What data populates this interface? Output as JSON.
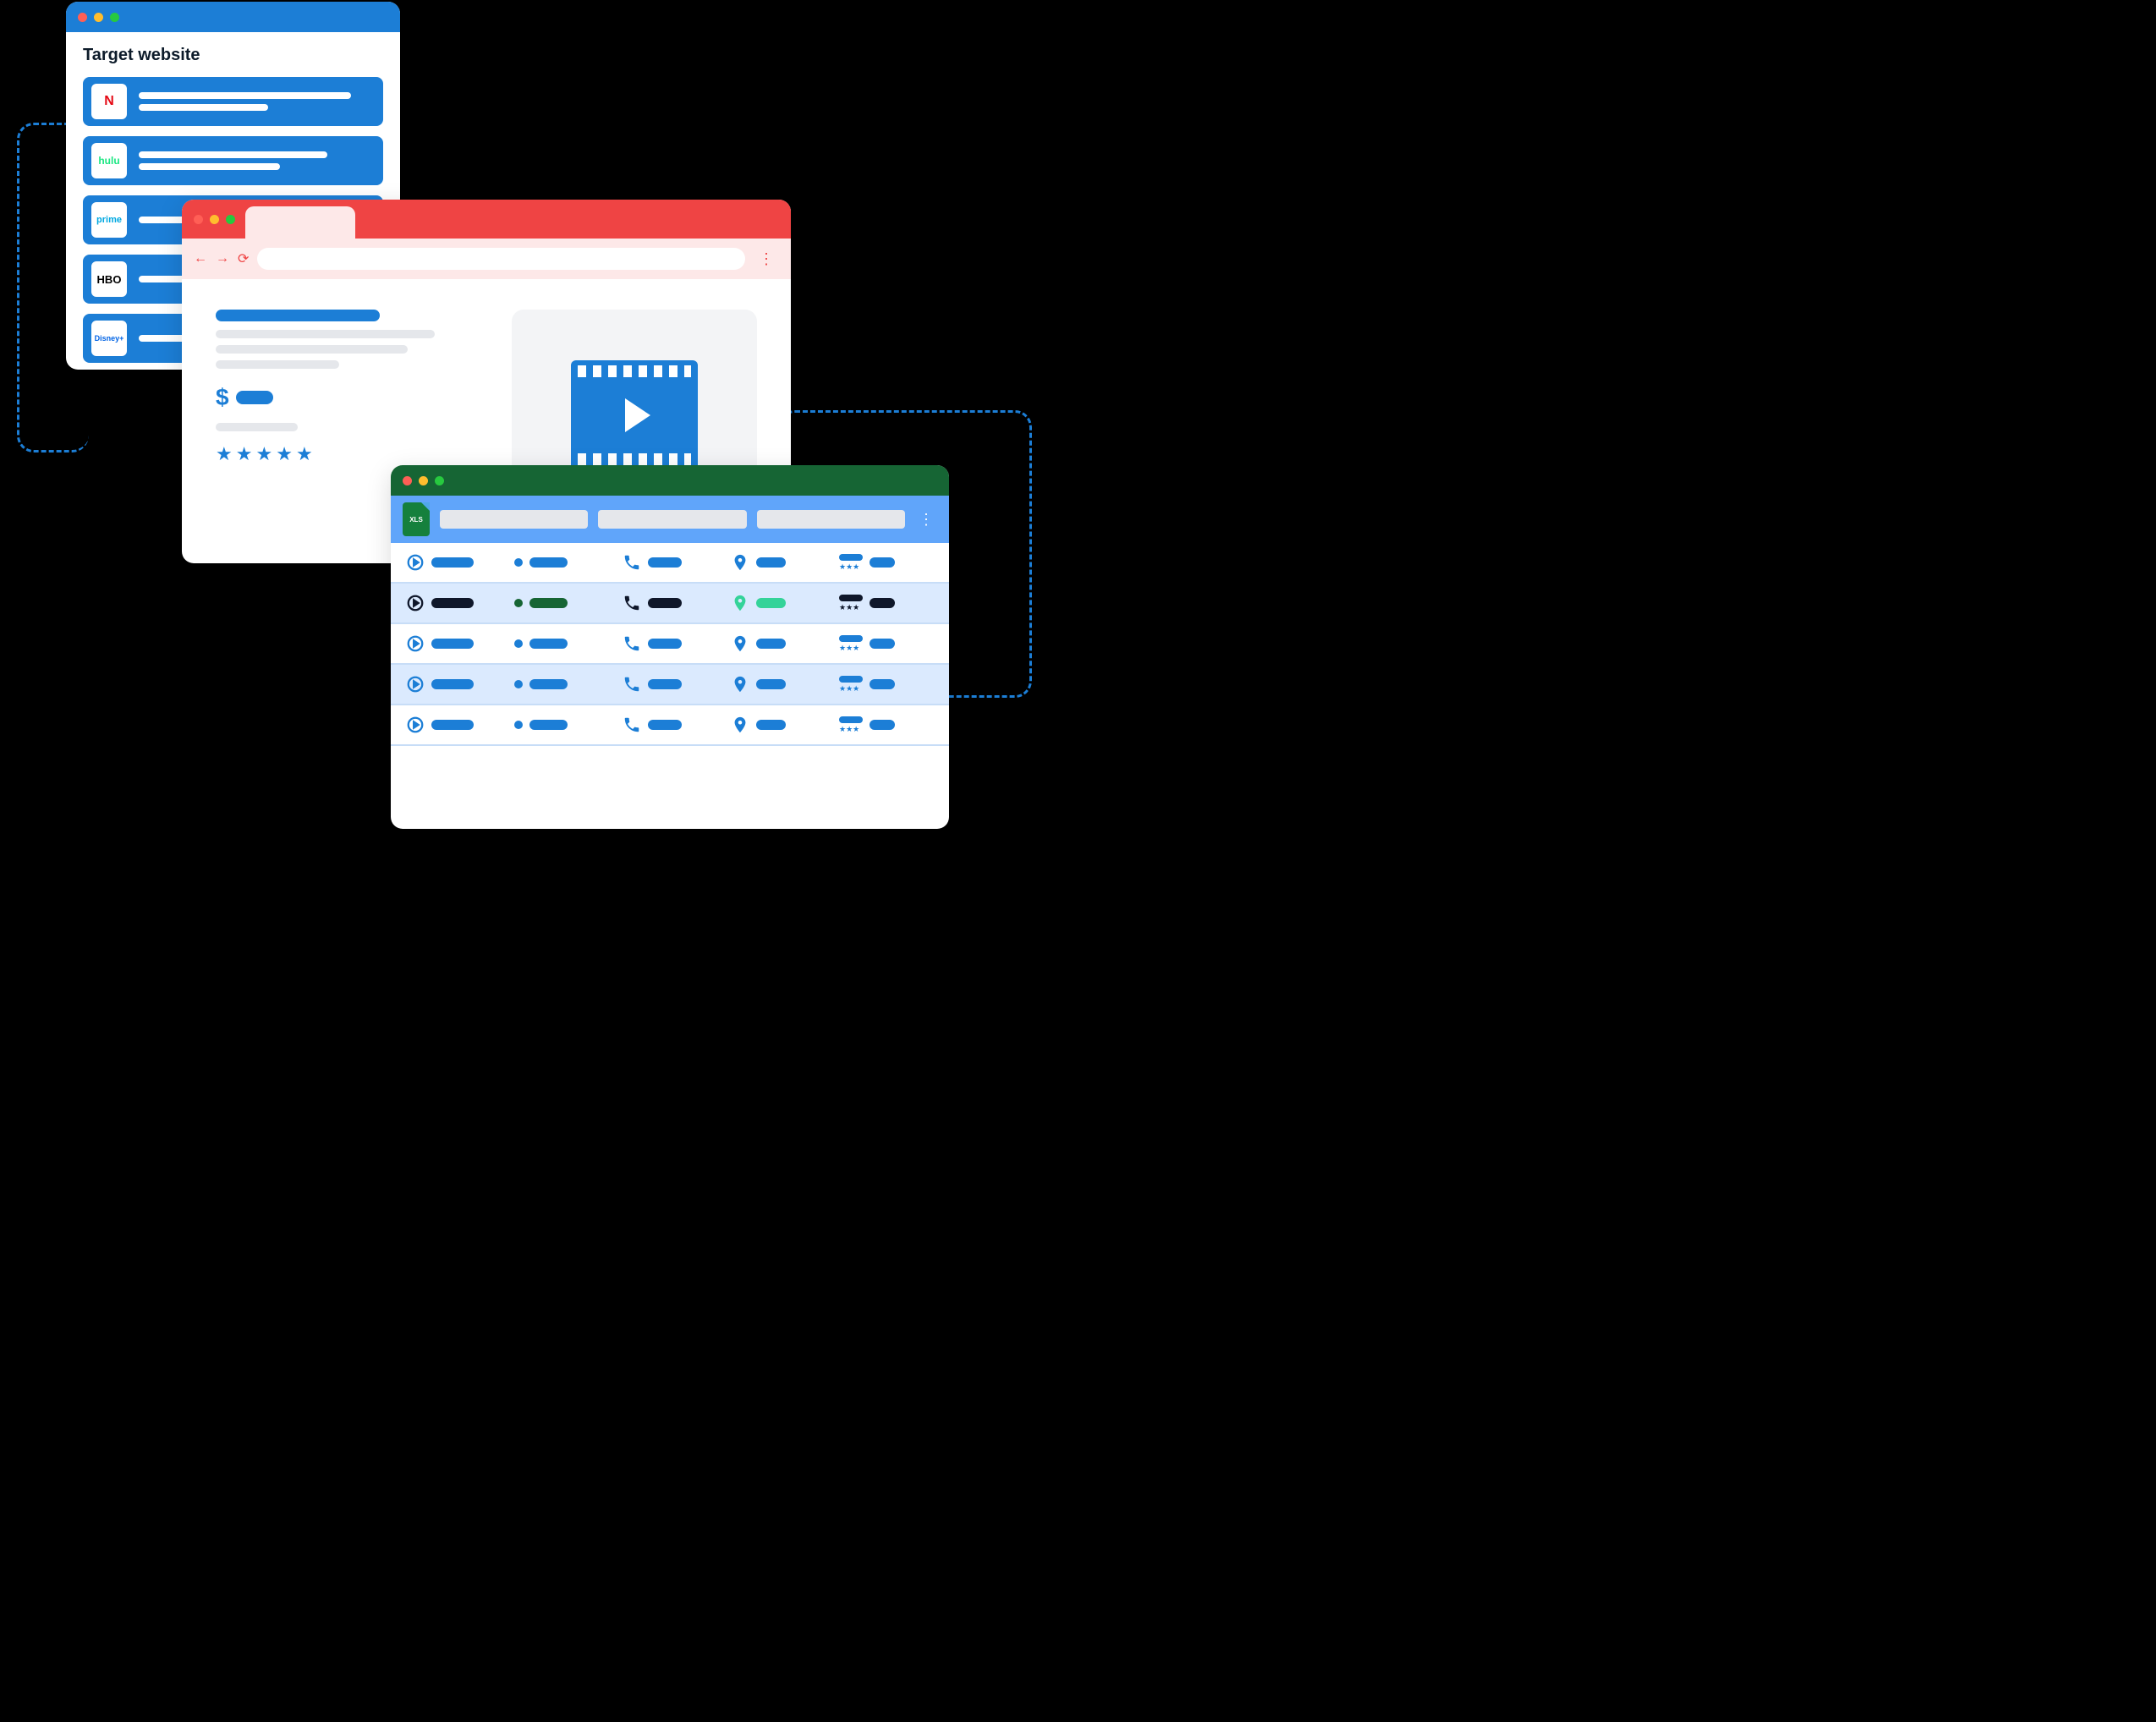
{
  "window1": {
    "title": "Target website",
    "sites": [
      {
        "logo": "N",
        "color": "#e50914"
      },
      {
        "logo": "hulu",
        "color": "#1ce783"
      },
      {
        "logo": "prime",
        "color": "#00a8e1"
      },
      {
        "logo": "HBO",
        "color": "#000000"
      },
      {
        "logo": "Disney+",
        "color": "#0063e5"
      }
    ]
  },
  "window2": {
    "currency": "$",
    "stars": 5
  },
  "window3": {
    "file_type": "XLS",
    "columns": [
      "play",
      "record",
      "phone",
      "location",
      "reviews"
    ],
    "rows": 5
  },
  "colors": {
    "primary_blue": "#1c7ed6",
    "browser_red": "#ef4444",
    "sheet_green": "#166534",
    "accent_mint": "#34d399"
  }
}
